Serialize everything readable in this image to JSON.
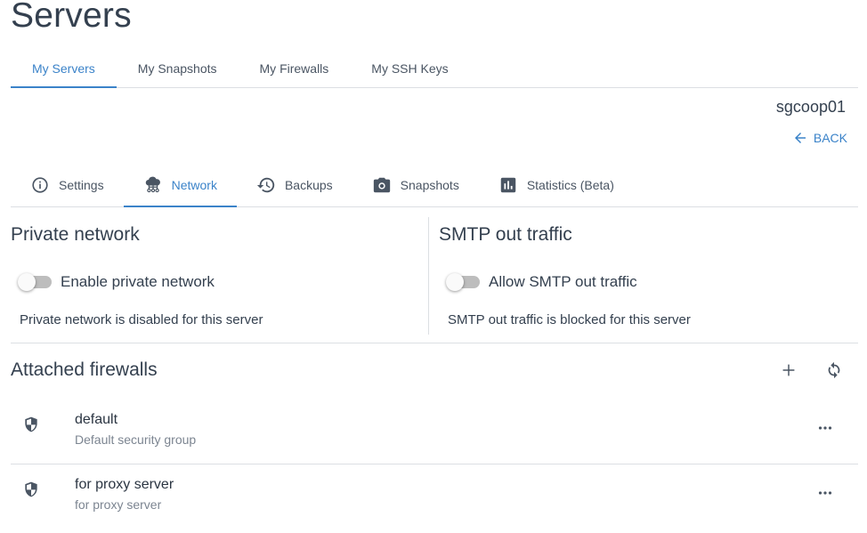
{
  "page": {
    "title": "Servers"
  },
  "top_tabs": [
    {
      "label": "My Servers",
      "active": true
    },
    {
      "label": "My Snapshots",
      "active": false
    },
    {
      "label": "My Firewalls",
      "active": false
    },
    {
      "label": "My SSH Keys",
      "active": false
    }
  ],
  "server": {
    "name": "sgcoop01",
    "back_label": "BACK"
  },
  "sub_tabs": [
    {
      "label": "Settings",
      "icon": "info-icon",
      "active": false
    },
    {
      "label": "Network",
      "icon": "cloud-network-icon",
      "active": true
    },
    {
      "label": "Backups",
      "icon": "history-icon",
      "active": false
    },
    {
      "label": "Snapshots",
      "icon": "camera-icon",
      "active": false
    },
    {
      "label": "Statistics (Beta)",
      "icon": "bar-chart-icon",
      "active": false
    }
  ],
  "private_network": {
    "heading": "Private network",
    "toggle_label": "Enable private network",
    "enabled": false,
    "status": "Private network is disabled for this server"
  },
  "smtp": {
    "heading": "SMTP out traffic",
    "toggle_label": "Allow SMTP out traffic",
    "enabled": false,
    "status": "SMTP out traffic is blocked for this server"
  },
  "firewalls": {
    "heading": "Attached firewalls",
    "items": [
      {
        "name": "default",
        "description": "Default security group"
      },
      {
        "name": "for proxy server",
        "description": "for proxy server"
      }
    ]
  },
  "colors": {
    "accent": "#3b83c9",
    "text": "#34404f",
    "muted": "#7c8591",
    "divider": "#dcdfe3"
  }
}
